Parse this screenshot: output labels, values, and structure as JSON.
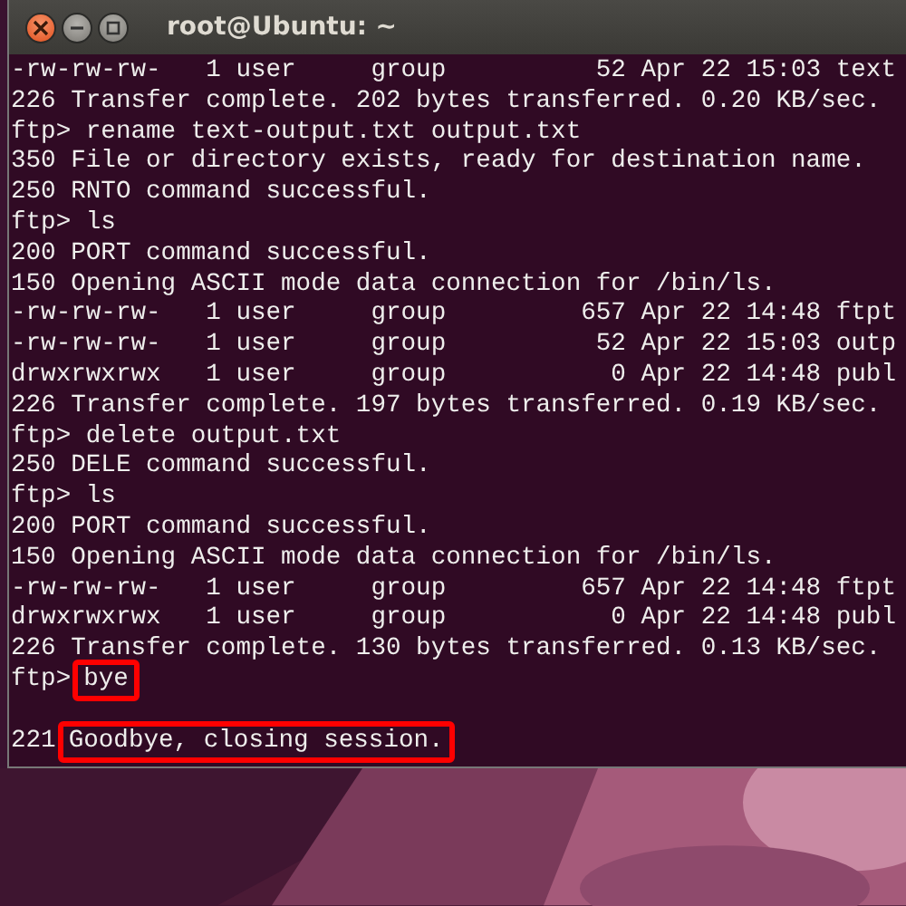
{
  "window": {
    "title": "root@Ubuntu: ~"
  },
  "terminal": {
    "lines": [
      {
        "kind": "output",
        "text": "-rw-rw-rw-   1 user     group          52 Apr 22 15:03 text"
      },
      {
        "kind": "output",
        "text": "226 Transfer complete. 202 bytes transferred. 0.20 KB/sec."
      },
      {
        "kind": "output",
        "text": "ftp> rename text-output.txt output.txt"
      },
      {
        "kind": "output",
        "text": "350 File or directory exists, ready for destination name."
      },
      {
        "kind": "output",
        "text": "250 RNTO command successful."
      },
      {
        "kind": "output",
        "text": "ftp> ls"
      },
      {
        "kind": "output",
        "text": "200 PORT command successful."
      },
      {
        "kind": "output",
        "text": "150 Opening ASCII mode data connection for /bin/ls."
      },
      {
        "kind": "output",
        "text": "-rw-rw-rw-   1 user     group         657 Apr 22 14:48 ftpt"
      },
      {
        "kind": "output",
        "text": "-rw-rw-rw-   1 user     group          52 Apr 22 15:03 outp"
      },
      {
        "kind": "output",
        "text": "drwxrwxrwx   1 user     group           0 Apr 22 14:48 publ"
      },
      {
        "kind": "output",
        "text": "226 Transfer complete. 197 bytes transferred. 0.19 KB/sec."
      },
      {
        "kind": "output",
        "text": "ftp> delete output.txt"
      },
      {
        "kind": "output",
        "text": "250 DELE command successful."
      },
      {
        "kind": "output",
        "text": "ftp> ls"
      },
      {
        "kind": "output",
        "text": "200 PORT command successful."
      },
      {
        "kind": "output",
        "text": "150 Opening ASCII mode data connection for /bin/ls."
      },
      {
        "kind": "output",
        "text": "-rw-rw-rw-   1 user     group         657 Apr 22 14:48 ftpt"
      },
      {
        "kind": "output",
        "text": "drwxrwxrwx   1 user     group           0 Apr 22 14:48 publ"
      },
      {
        "kind": "output",
        "text": "226 Transfer complete. 130 bytes transferred. 0.13 KB/sec."
      },
      {
        "kind": "highlight",
        "text": "ftp>",
        "highlighted": "bye"
      },
      {
        "kind": "blank"
      },
      {
        "kind": "highlight",
        "text": "221",
        "highlighted": "Goodbye, closing session."
      }
    ]
  }
}
